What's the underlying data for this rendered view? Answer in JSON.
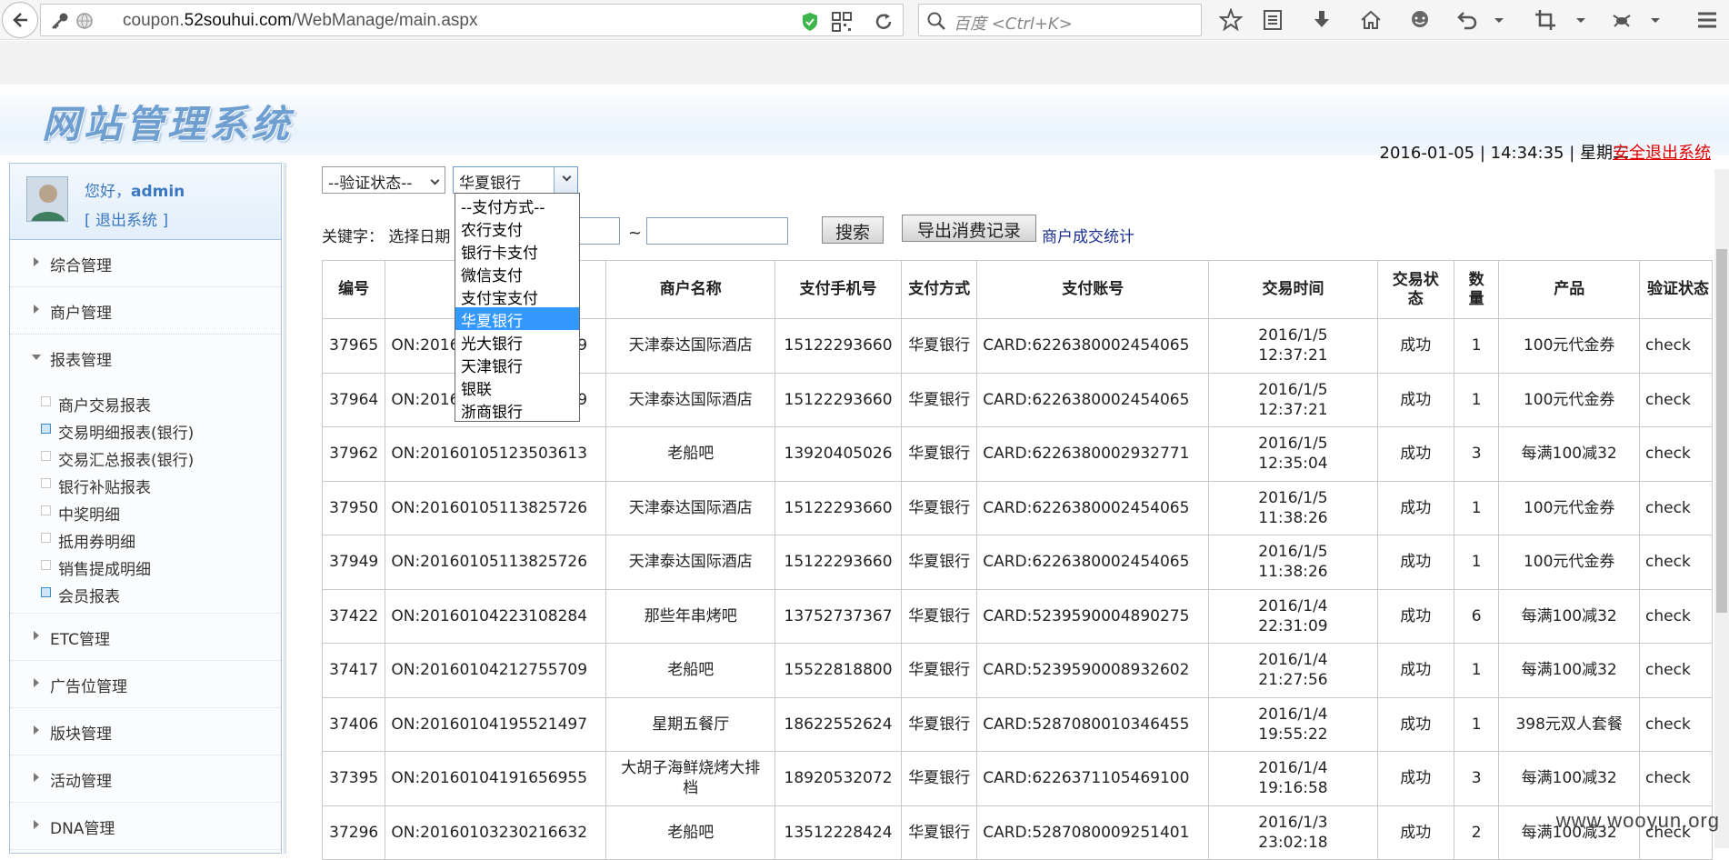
{
  "browser": {
    "url_prefix": "coupon.",
    "url_domain": "52souhui.com",
    "url_path": "/WebManage/main.aspx",
    "search_placeholder": "百度 <Ctrl+K>"
  },
  "header": {
    "logo_text": "网站管理系统",
    "datetime": "2016-01-05 | 14:34:35 | 星期二",
    "logout_label": "安全退出系统"
  },
  "user": {
    "greeting_prefix": "您好，",
    "username": "admin",
    "exit_label": "[ 退出系统 ]"
  },
  "sidebar": {
    "groups": [
      {
        "label": "综合管理"
      },
      {
        "label": "商户管理"
      },
      {
        "label": "报表管理"
      },
      {
        "label": "ETC管理"
      },
      {
        "label": "广告位管理"
      },
      {
        "label": "版块管理"
      },
      {
        "label": "活动管理"
      },
      {
        "label": "DNA管理"
      }
    ],
    "report_items": [
      {
        "label": "商户交易报表"
      },
      {
        "label": "交易明细报表(银行)"
      },
      {
        "label": "交易汇总报表(银行)"
      },
      {
        "label": "银行补贴报表"
      },
      {
        "label": "中奖明细"
      },
      {
        "label": "抵用券明细"
      },
      {
        "label": "销售提成明细"
      },
      {
        "label": "会员报表"
      }
    ]
  },
  "filters": {
    "verify_status": "--验证状态--",
    "pay_method": "华夏银行",
    "keyword_label": "关键字：",
    "date_label": "选择日期",
    "search_button": "搜索",
    "export_button": "导出消费记录",
    "stats_link": "商户成交统计",
    "pay_options": [
      "--支付方式--",
      "农行支付",
      "银行卡支付",
      "微信支付",
      "支付宝支付",
      "华夏银行",
      "光大银行",
      "天津银行",
      "银联",
      "浙商银行"
    ]
  },
  "table": {
    "headers": [
      "编号",
      "",
      "商户名称",
      "支付手机号",
      "支付方式",
      "支付账号",
      "交易时间",
      "交易状态",
      "数量",
      "产品",
      "验证状态"
    ],
    "rows": [
      {
        "id": "37965",
        "order": "ON:20160105123721849",
        "merchant": "天津泰达国际酒店",
        "phone": "15122293660",
        "method": "华夏银行",
        "account": "CARD:6226380002454065",
        "date": "2016/1/5",
        "time": "12:37:21",
        "status": "成功",
        "qty": "1",
        "product": "100元代金券",
        "verify": "check"
      },
      {
        "id": "37964",
        "order": "ON:20160105123721849",
        "merchant": "天津泰达国际酒店",
        "phone": "15122293660",
        "method": "华夏银行",
        "account": "CARD:6226380002454065",
        "date": "2016/1/5",
        "time": "12:37:21",
        "status": "成功",
        "qty": "1",
        "product": "100元代金券",
        "verify": "check"
      },
      {
        "id": "37962",
        "order": "ON:20160105123503613",
        "merchant": "老船吧",
        "phone": "13920405026",
        "method": "华夏银行",
        "account": "CARD:6226380002932771",
        "date": "2016/1/5",
        "time": "12:35:04",
        "status": "成功",
        "qty": "3",
        "product": "每满100减32",
        "verify": "check"
      },
      {
        "id": "37950",
        "order": "ON:20160105113825726",
        "merchant": "天津泰达国际酒店",
        "phone": "15122293660",
        "method": "华夏银行",
        "account": "CARD:6226380002454065",
        "date": "2016/1/5",
        "time": "11:38:26",
        "status": "成功",
        "qty": "1",
        "product": "100元代金券",
        "verify": "check"
      },
      {
        "id": "37949",
        "order": "ON:20160105113825726",
        "merchant": "天津泰达国际酒店",
        "phone": "15122293660",
        "method": "华夏银行",
        "account": "CARD:6226380002454065",
        "date": "2016/1/5",
        "time": "11:38:26",
        "status": "成功",
        "qty": "1",
        "product": "100元代金券",
        "verify": "check"
      },
      {
        "id": "37422",
        "order": "ON:20160104223108284",
        "merchant": "那些年串烤吧",
        "phone": "13752737367",
        "method": "华夏银行",
        "account": "CARD:5239590004890275",
        "date": "2016/1/4",
        "time": "22:31:09",
        "status": "成功",
        "qty": "6",
        "product": "每满100减32",
        "verify": "check"
      },
      {
        "id": "37417",
        "order": "ON:20160104212755709",
        "merchant": "老船吧",
        "phone": "15522818800",
        "method": "华夏银行",
        "account": "CARD:5239590008932602",
        "date": "2016/1/4",
        "time": "21:27:56",
        "status": "成功",
        "qty": "1",
        "product": "每满100减32",
        "verify": "check"
      },
      {
        "id": "37406",
        "order": "ON:20160104195521497",
        "merchant": "星期五餐厅",
        "phone": "18622552624",
        "method": "华夏银行",
        "account": "CARD:5287080010346455",
        "date": "2016/1/4",
        "time": "19:55:22",
        "status": "成功",
        "qty": "1",
        "product": "398元双人套餐",
        "verify": "check"
      },
      {
        "id": "37395",
        "order": "ON:20160104191656955",
        "merchant": "大胡子海鲜烧烤大排档",
        "phone": "18920532072",
        "method": "华夏银行",
        "account": "CARD:6226371105469100",
        "date": "2016/1/4",
        "time": "19:16:58",
        "status": "成功",
        "qty": "3",
        "product": "每满100减32",
        "verify": "check"
      },
      {
        "id": "37296",
        "order": "ON:20160103230216632",
        "merchant": "老船吧",
        "phone": "13512228424",
        "method": "华夏银行",
        "account": "CARD:5287080009251401",
        "date": "2016/1/3",
        "time": "23:02:18",
        "status": "成功",
        "qty": "2",
        "product": "每满100减32",
        "verify": "check"
      }
    ]
  },
  "watermark": "www.wooyun.org"
}
